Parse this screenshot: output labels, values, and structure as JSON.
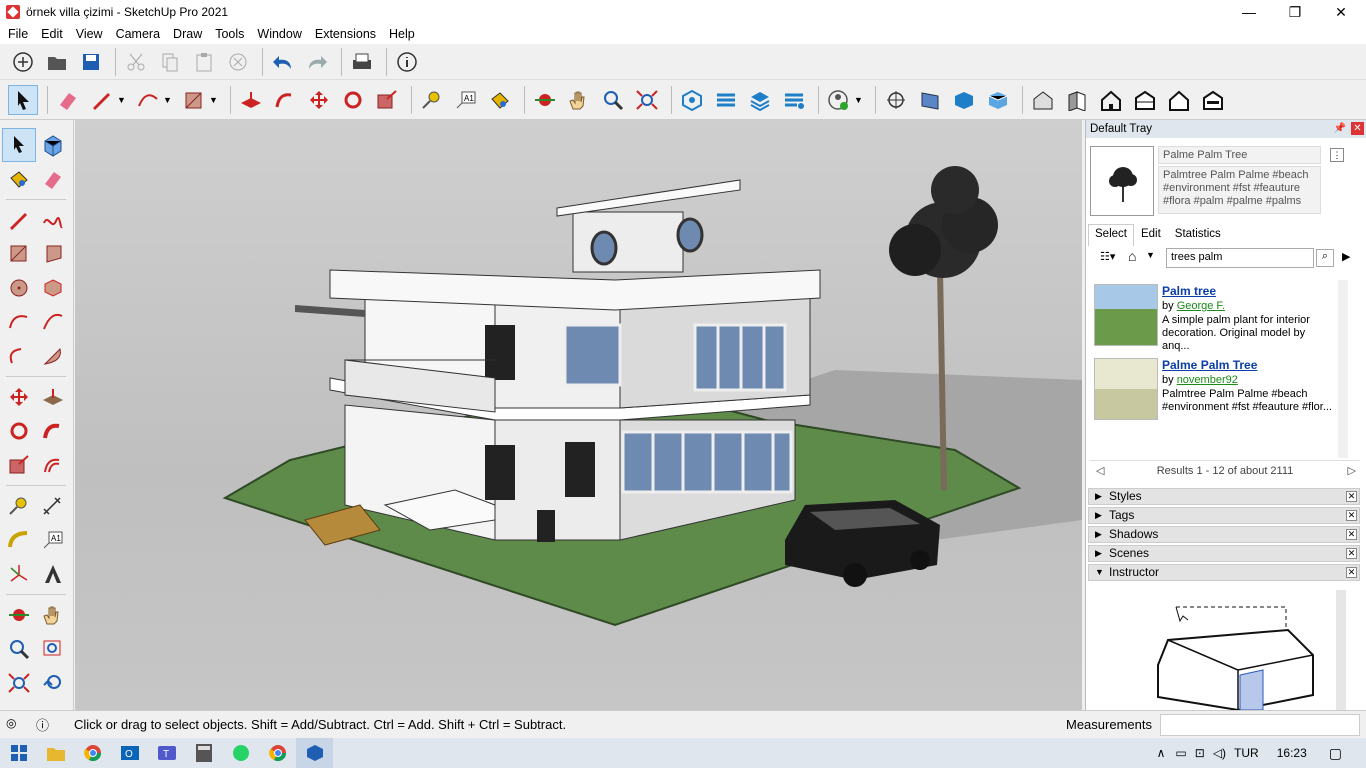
{
  "window": {
    "title": "örnek villa çizimi - SketchUp Pro 2021",
    "minimize": "—",
    "maximize": "❐",
    "close": "✕"
  },
  "menu": [
    "File",
    "Edit",
    "View",
    "Camera",
    "Draw",
    "Tools",
    "Window",
    "Extensions",
    "Help"
  ],
  "tray": {
    "title": "Default Tray",
    "preview_name": "Palme Palm Tree",
    "preview_desc": "Palmtree Palm Palme #beach #environment #fst #feauture #flora #palm #palme #palms",
    "tabs": [
      "Select",
      "Edit",
      "Statistics"
    ],
    "search_value": "trees palm",
    "results": [
      {
        "title": "Palm tree",
        "by_label": "by",
        "author": "George F.",
        "desc": "A simple palm plant for interior decoration. Original model by anq..."
      },
      {
        "title": "Palme Palm Tree",
        "by_label": "by",
        "author": "november92",
        "desc": "Palmtree Palm Palme #beach #environment #fst #feauture #flor..."
      }
    ],
    "results_footer": "Results 1 - 12 of about 2111",
    "panels": [
      "Styles",
      "Tags",
      "Shadows",
      "Scenes",
      "Instructor"
    ]
  },
  "status": {
    "message": "Click or drag to select objects. Shift = Add/Subtract. Ctrl = Add. Shift + Ctrl = Subtract.",
    "measurements": "Measurements"
  },
  "taskbar": {
    "lang": "TUR",
    "time": "16:23"
  },
  "colors": {
    "accent": "#0b3ea8",
    "ground": "#5e8a4a",
    "sky": "#c9c9c9"
  }
}
